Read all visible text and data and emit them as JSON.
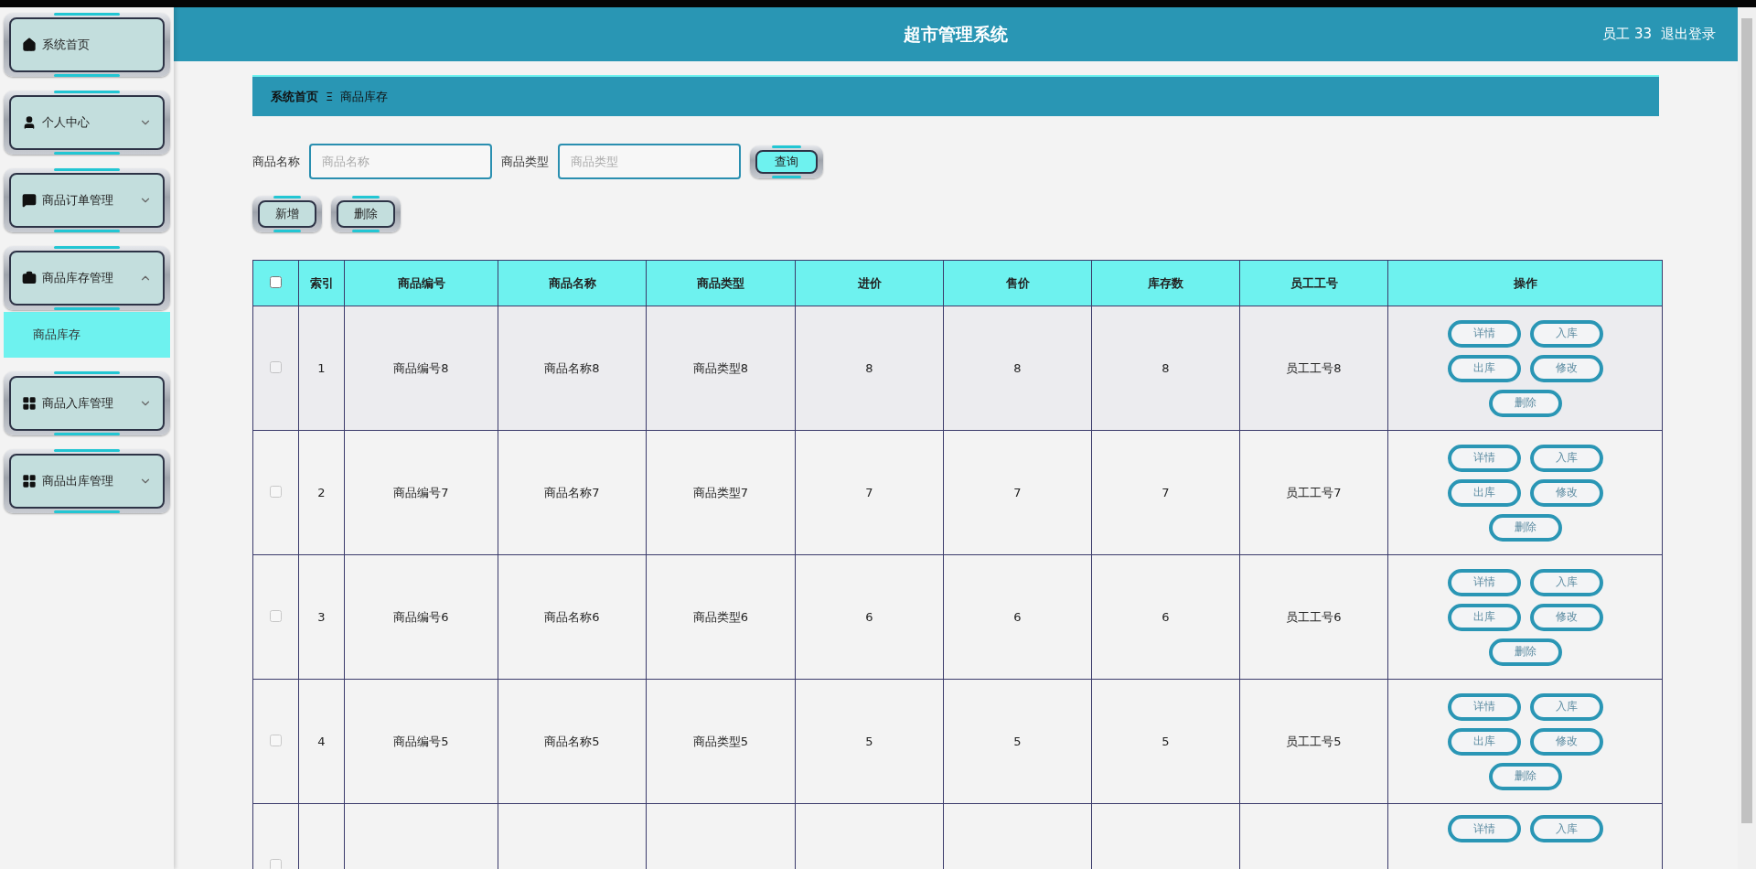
{
  "header": {
    "title": "超市管理系统",
    "user": "员工 33",
    "logout": "退出登录"
  },
  "sidebar": {
    "items": [
      {
        "kind": "link",
        "label": "系统首页"
      },
      {
        "kind": "group",
        "label": "个人中心",
        "expanded": false
      },
      {
        "kind": "group",
        "label": "商品订单管理",
        "expanded": false
      },
      {
        "kind": "group",
        "label": "商品库存管理",
        "expanded": true,
        "children": [
          {
            "label": "商品库存",
            "selected": true
          }
        ]
      },
      {
        "kind": "group",
        "label": "商品入库管理",
        "expanded": false
      },
      {
        "kind": "group",
        "label": "商品出库管理",
        "expanded": false
      }
    ]
  },
  "breadcrumb": {
    "home": "系统首页",
    "separator": "Ξ",
    "current": "商品库存"
  },
  "search": {
    "fields": [
      {
        "label": "商品名称",
        "placeholder": "商品名称"
      },
      {
        "label": "商品类型",
        "placeholder": "商品类型"
      }
    ],
    "button": "查询"
  },
  "actions": [
    "新增",
    "删除"
  ],
  "table": {
    "select_all": {
      "checked": false
    },
    "columns": [
      "索引",
      "商品编号",
      "商品名称",
      "商品类型",
      "进价",
      "售价",
      "库存数",
      "员工工号",
      "操作"
    ],
    "rows": [
      {
        "checked": false,
        "cells": [
          "1",
          "商品编号8",
          "商品名称8",
          "商品类型8",
          "8",
          "8",
          "8",
          "员工工号8"
        ],
        "buttons": [
          "详情",
          "入库",
          "出库",
          "修改",
          "删除"
        ]
      },
      {
        "checked": false,
        "cells": [
          "2",
          "商品编号7",
          "商品名称7",
          "商品类型7",
          "7",
          "7",
          "7",
          "员工工号7"
        ],
        "buttons": [
          "详情",
          "入库",
          "出库",
          "修改",
          "删除"
        ]
      },
      {
        "checked": false,
        "cells": [
          "3",
          "商品编号6",
          "商品名称6",
          "商品类型6",
          "6",
          "6",
          "6",
          "员工工号6"
        ],
        "buttons": [
          "详情",
          "入库",
          "出库",
          "修改",
          "删除"
        ]
      },
      {
        "checked": false,
        "cells": [
          "4",
          "商品编号5",
          "商品名称5",
          "商品类型5",
          "5",
          "5",
          "5",
          "员工工号5"
        ],
        "buttons": [
          "详情",
          "入库",
          "出库",
          "修改",
          "删除"
        ]
      },
      {
        "checked": false,
        "cells": [],
        "buttons": [
          "详情",
          "入库"
        ]
      }
    ]
  }
}
